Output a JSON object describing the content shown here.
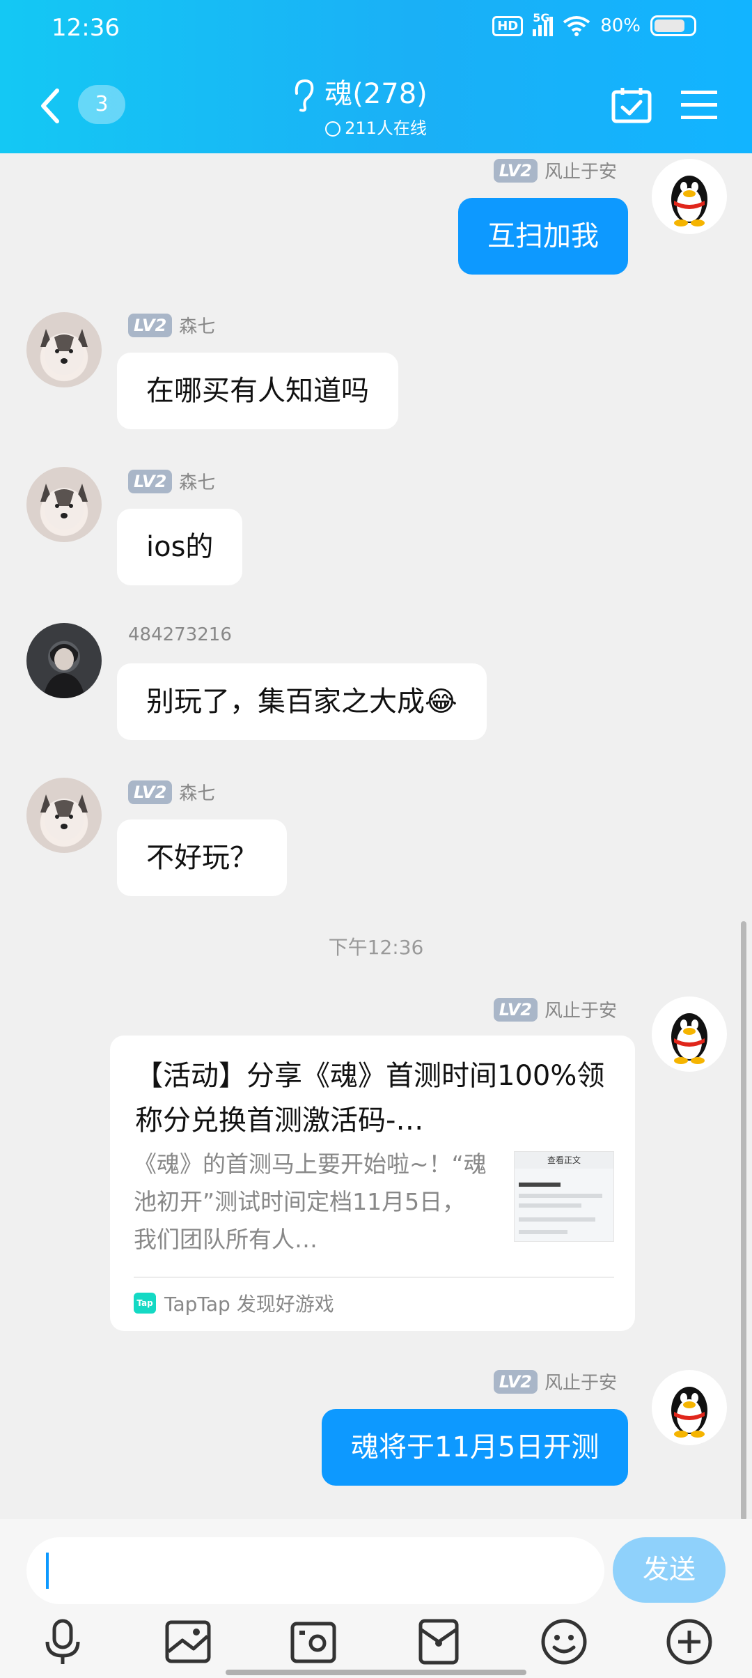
{
  "status": {
    "time": "12:36",
    "hd": "HD",
    "network": "5G",
    "battery": "80%",
    "battery_level": 0.8
  },
  "header": {
    "back_count": "3",
    "title": "魂(278)",
    "online": "211人在线"
  },
  "messages": [
    {
      "sender_level": "LV2",
      "sender": "风止于安",
      "text": "互扫加我"
    },
    {
      "sender_level": "LV2",
      "sender": "森七",
      "text": "在哪买有人知道吗"
    },
    {
      "sender_level": "LV2",
      "sender": "森七",
      "text": "ios的"
    },
    {
      "sender": "484273216",
      "text": "别玩了，集百家之大成😂"
    },
    {
      "sender_level": "LV2",
      "sender": "森七",
      "text": "不好玩？"
    },
    {
      "sender_level": "LV2",
      "sender": "风止于安"
    },
    {
      "sender_level": "LV2",
      "sender": "风止于安",
      "text": "魂将于11月5日开测"
    }
  ],
  "time_separator": "下午12:36",
  "card": {
    "title": "【活动】分享《魂》首测时间100%领称分兑换首测激活码-…",
    "description": "《魂》的首测马上要开始啦~！“魂池初开”测试时间定档11月5日，我们团队所有人…",
    "thumb_header": "查看正文",
    "source_logo": "Tap",
    "source": "TapTap 发现好游戏"
  },
  "input": {
    "placeholder": "",
    "send_label": "发送"
  },
  "icons": [
    "back-icon",
    "ear-icon",
    "calendar-check-icon",
    "menu-icon",
    "microphone-icon",
    "image-icon",
    "camera-icon",
    "red-packet-icon",
    "emoji-icon",
    "plus-icon"
  ],
  "colors": {
    "header": "#14c8f4",
    "bubble_out": "#0d99ff",
    "send_button": "#8fd1fb",
    "level_badge": "#a9b6c8"
  }
}
